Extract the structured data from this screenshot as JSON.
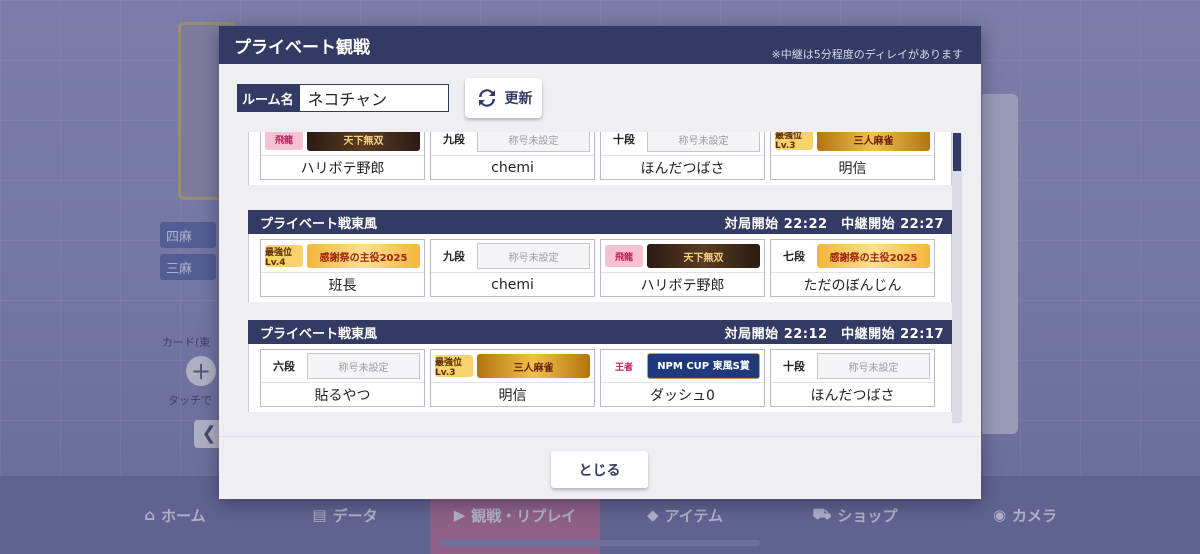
{
  "background": {
    "mode_chips": [
      "四麻",
      "三麻"
    ],
    "card_label": "カード(東",
    "touch_label": "タッチで",
    "nav": [
      {
        "label": "ホーム",
        "icon": "home-icon"
      },
      {
        "label": "データ",
        "icon": "data-icon"
      },
      {
        "label": "観戦・リプレイ",
        "icon": "watch-icon"
      },
      {
        "label": "アイテム",
        "icon": "item-icon"
      },
      {
        "label": "ショップ",
        "icon": "shop-icon"
      },
      {
        "label": "カメラ",
        "icon": "camera-icon"
      }
    ]
  },
  "modal": {
    "title": "プライベート観戦",
    "subtitle": "※中継は5分程度のディレイがあります",
    "room_label": "ルーム名",
    "room_value": "ネコチャン",
    "refresh_label": "更新",
    "close_label": "とじる"
  },
  "matches": [
    {
      "players": [
        {
          "rank": "飛龍",
          "title": "天下無双",
          "title_style": "dark",
          "badge": "dragon",
          "name": "ハリボテ野郎"
        },
        {
          "rank": "九段",
          "title": "称号未設定",
          "title_style": "empty",
          "name": "chemi"
        },
        {
          "rank": "十段",
          "title": "称号未設定",
          "title_style": "empty",
          "name": "ほんだつばさ"
        },
        {
          "rank": "最強位Lv.3",
          "title": "三人麻雀",
          "title_style": "gold",
          "badge": "saikyo",
          "name": "明信"
        }
      ]
    },
    {
      "name": "プライベート戦東風",
      "start": "対局開始 22:22",
      "relay": "中継開始 22:27",
      "players": [
        {
          "rank": "最強位Lv.4",
          "title": "感謝祭の主役2025",
          "title_style": "thanks",
          "badge": "saikyo",
          "name": "班長"
        },
        {
          "rank": "九段",
          "title": "称号未設定",
          "title_style": "empty",
          "name": "chemi"
        },
        {
          "rank": "飛龍",
          "title": "天下無双",
          "title_style": "dark",
          "badge": "dragon",
          "name": "ハリボテ野郎"
        },
        {
          "rank": "七段",
          "title": "感謝祭の主役2025",
          "title_style": "thanks",
          "name": "ただのぼんじん"
        }
      ]
    },
    {
      "name": "プライベート戦東風",
      "start": "対局開始 22:12",
      "relay": "中継開始 22:17",
      "players": [
        {
          "rank": "六段",
          "title": "称号未設定",
          "title_style": "empty",
          "name": "貼るやつ"
        },
        {
          "rank": "最強位Lv.3",
          "title": "三人麻雀",
          "title_style": "gold",
          "badge": "saikyo",
          "name": "明信"
        },
        {
          "rank": "王者",
          "title": "NPM CUP 東風S賞",
          "title_style": "npm",
          "badge": "king",
          "name": "ダッシュ0"
        },
        {
          "rank": "十段",
          "title": "称号未設定",
          "title_style": "empty",
          "name": "ほんだつばさ"
        }
      ]
    }
  ],
  "colors": {
    "header": "#333a63",
    "panel": "#efeff3",
    "accent_gold": "#f0c14a"
  }
}
